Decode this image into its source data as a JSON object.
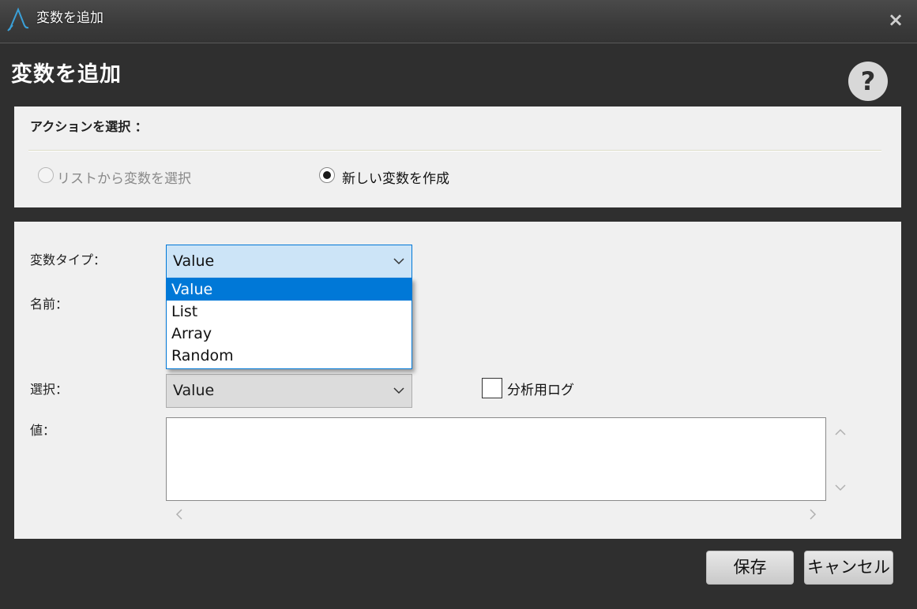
{
  "window": {
    "title": "変数を追加",
    "close_icon": "×"
  },
  "dialog": {
    "heading": "変数を追加",
    "help_icon": "?"
  },
  "action_section": {
    "title": "アクションを選択 ：",
    "options": [
      {
        "label": "リストから変数を選択",
        "checked": false,
        "enabled": false
      },
      {
        "label": "新しい変数を作成",
        "checked": true,
        "enabled": true
      }
    ]
  },
  "form": {
    "type_label": "変数タイプ：",
    "type_selected": "Value",
    "type_options": [
      "Value",
      "List",
      "Array",
      "Random"
    ],
    "name_label": "名前：",
    "select_label": "選択：",
    "select_value": "Value",
    "log_label": "分析用ログ",
    "value_label": "値：",
    "value_text": ""
  },
  "buttons": {
    "save": "保存",
    "cancel": "キャンセル"
  },
  "colors": {
    "accent": "#0078d7",
    "background": "#2f2f2f",
    "panel": "#f0f0f0"
  }
}
